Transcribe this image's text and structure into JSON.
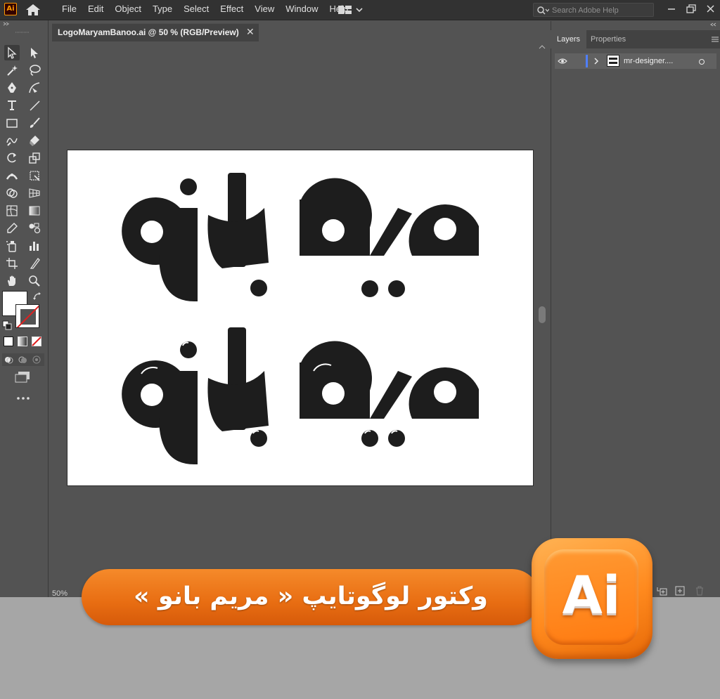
{
  "app": {
    "logo_text": "Ai",
    "brand_color": "#ff9a00"
  },
  "menu": [
    "File",
    "Edit",
    "Object",
    "Type",
    "Select",
    "Effect",
    "View",
    "Window",
    "Help"
  ],
  "search": {
    "placeholder": "Search Adobe Help"
  },
  "document": {
    "tab_title": "LogoMaryamBanoo.ai @ 50 % (RGB/Preview)",
    "close_glyph": "✕",
    "zoom": "50%"
  },
  "panel": {
    "tabs": [
      "Layers",
      "Properties"
    ],
    "active_tab": "Layers",
    "layers": [
      {
        "name": "mr-designer....",
        "visible": true
      }
    ]
  },
  "artwork": {
    "logo_word": "مریم بانو",
    "variants": [
      "flat",
      "glossy"
    ],
    "fill": "#1d1d1d"
  },
  "banner": {
    "text": "وکتور لوگوتایپ « مریم بانو »",
    "color": "#ee7318"
  },
  "badge": {
    "text": "Ai"
  },
  "tools": [
    "selection",
    "direct-selection",
    "magic-wand",
    "lasso",
    "pen",
    "curvature",
    "type",
    "line",
    "rectangle",
    "paintbrush",
    "shaper",
    "eraser",
    "rotate",
    "scale",
    "width",
    "free-transform",
    "shape-builder",
    "perspective-grid",
    "mesh",
    "gradient",
    "eyedropper",
    "blend",
    "symbol-sprayer",
    "column-graph",
    "artboard",
    "slice",
    "hand",
    "zoom"
  ]
}
